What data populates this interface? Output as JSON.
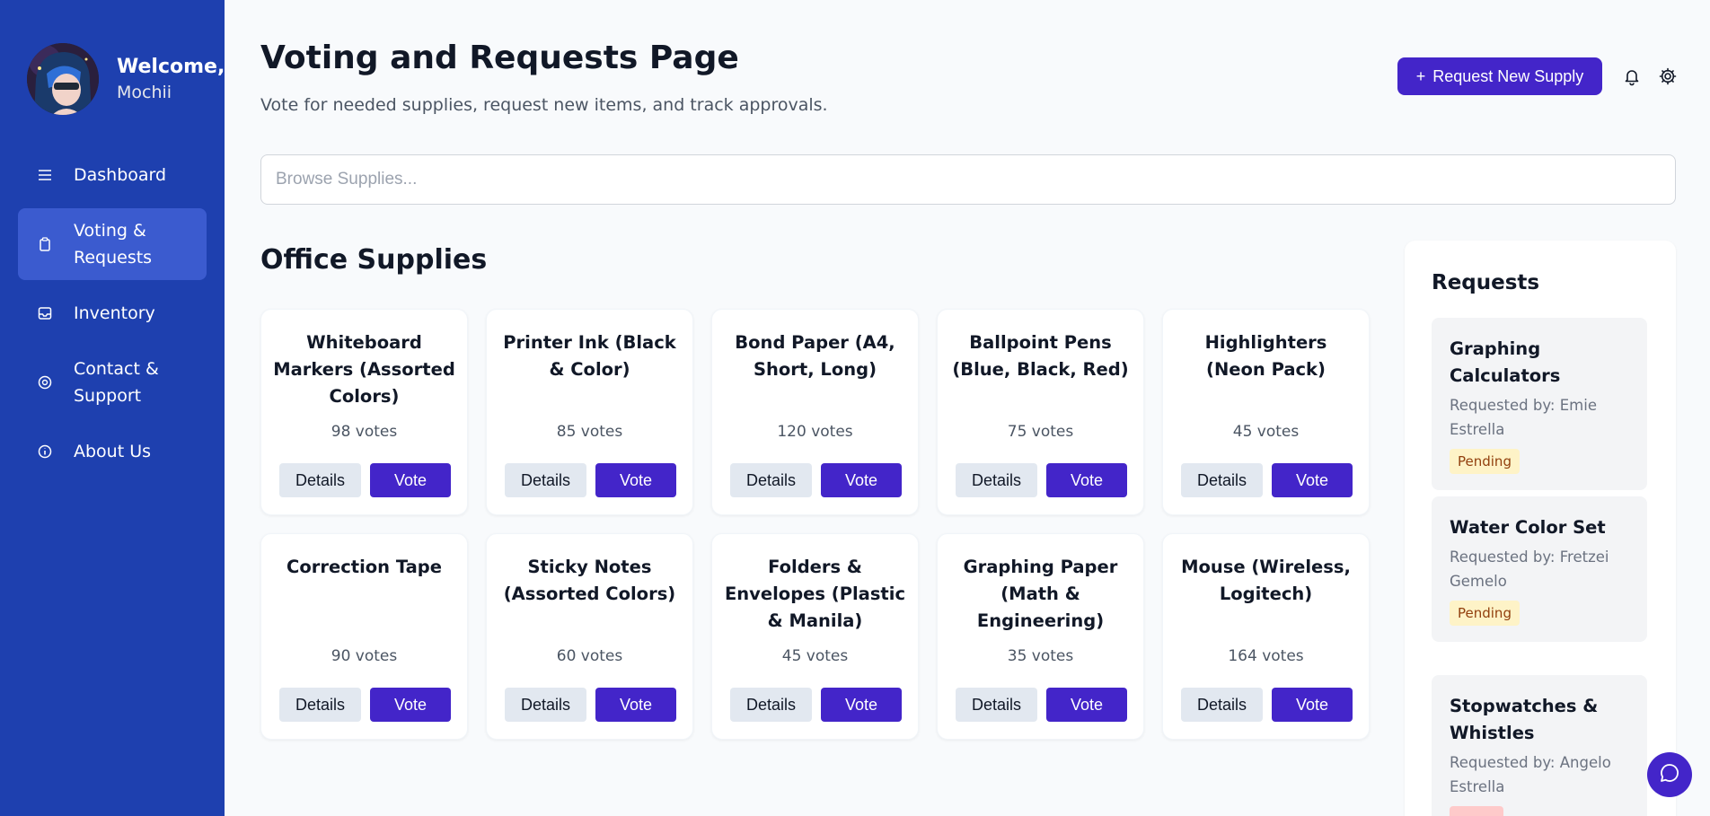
{
  "user": {
    "welcome": "Welcome,",
    "name": "Mochii"
  },
  "nav": [
    {
      "label": "Dashboard",
      "icon": "menu-icon",
      "active": false
    },
    {
      "label": "Voting & Requests",
      "icon": "clipboard-icon",
      "active": true
    },
    {
      "label": "Inventory",
      "icon": "inbox-icon",
      "active": false
    },
    {
      "label": "Contact & Support",
      "icon": "globe-icon",
      "active": false
    },
    {
      "label": "About Us",
      "icon": "info-icon",
      "active": false
    }
  ],
  "header": {
    "title": "Voting and Requests Page",
    "subtitle": "Vote for needed supplies, request new items, and track approvals.",
    "request_button": "Request New Supply",
    "request_button_icon": "+"
  },
  "search": {
    "placeholder": "Browse Supplies..."
  },
  "section": {
    "title": "Office Supplies"
  },
  "buttons": {
    "details": "Details",
    "vote": "Vote"
  },
  "supplies": [
    {
      "name": "Whiteboard Markers (Assorted Colors)",
      "votes": "98 votes"
    },
    {
      "name": "Printer Ink (Black & Color)",
      "votes": "85 votes"
    },
    {
      "name": "Bond Paper (A4, Short, Long)",
      "votes": "120 votes"
    },
    {
      "name": "Ballpoint Pens (Blue, Black, Red)",
      "votes": "75 votes"
    },
    {
      "name": "Highlighters (Neon Pack)",
      "votes": "45 votes"
    },
    {
      "name": "Correction Tape",
      "votes": "90 votes"
    },
    {
      "name": "Sticky Notes (Assorted Colors)",
      "votes": "60 votes"
    },
    {
      "name": "Folders & Envelopes (Plastic & Manila)",
      "votes": "45 votes"
    },
    {
      "name": "Graphing Paper (Math & Engineering)",
      "votes": "35 votes"
    },
    {
      "name": "Mouse (Wireless, Logitech)",
      "votes": "164 votes"
    }
  ],
  "requests": {
    "title": "Requests",
    "items": [
      {
        "title": "Graphing Calculators",
        "by": "Requested by: Emie Estrella",
        "status": "Pending"
      },
      {
        "title": "Water Color Set",
        "by": "Requested by: Fretzei Gemelo",
        "status": "Pending"
      },
      {
        "title": "Stopwatches & Whistles",
        "by": "Requested by: Angelo Estrella",
        "status": ""
      }
    ]
  },
  "colors": {
    "sidebar": "#1e40af",
    "accent": "#4325c9",
    "pending_bg": "#fef3c7"
  }
}
